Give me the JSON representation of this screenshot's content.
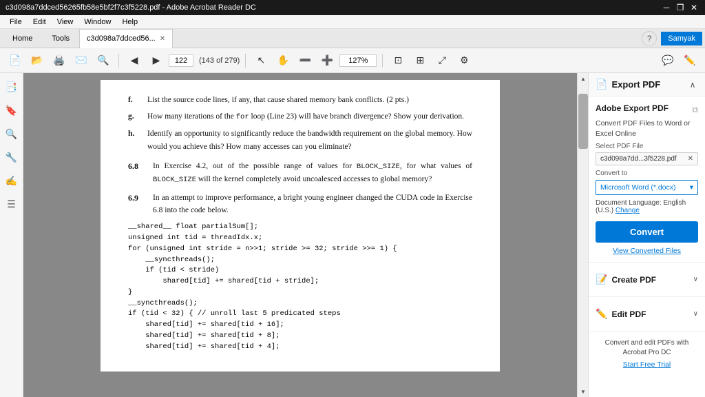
{
  "titlebar": {
    "title": "c3d098a7ddced56265fb58e5bf2f7c3f5228.pdf - Adobe Acrobat Reader DC",
    "minimize": "─",
    "restore": "❐",
    "close": "✕"
  },
  "menubar": {
    "items": [
      "File",
      "Edit",
      "View",
      "Window",
      "Help"
    ]
  },
  "tabs": {
    "home": "Home",
    "tools": "Tools",
    "doc": "c3d098a7ddced56...",
    "question_icon": "?",
    "user": "Samyak"
  },
  "toolbar": {
    "page_num": "122",
    "page_total": "(143 of 279)",
    "zoom": "127%"
  },
  "pdf": {
    "items_f_to_h": [
      {
        "label": "f.",
        "text": "List the source code lines, if any, that cause shared memory bank conflicts. (2 pts.)"
      },
      {
        "label": "g.",
        "text": "How many iterations of the for loop (Line 23) will have branch divergence? Show your derivation."
      },
      {
        "label": "h.",
        "text": "Identify an opportunity to significantly reduce the bandwidth requirement on the global memory. How would you achieve this? How many accesses can you eliminate?"
      }
    ],
    "section_6_8": {
      "num": "6.8",
      "text": "In Exercise 4.2, out of the possible range of values for BLOCK_SIZE, for what values of BLOCK_SIZE will the kernel completely avoid uncoalesced accesses to global memory?"
    },
    "section_6_9": {
      "num": "6.9",
      "text": "In an attempt to improve performance, a bright young engineer changed the CUDA code in Exercise 6.8 into the code below."
    },
    "code": "__shared__ float partialSum[];\nunsigned int tid = threadIdx.x;\nfor (unsigned int stride = n>>1; stride >= 32; stride >>= 1) {\n    __syncthreads();\n    if (tid < stride)\n        shared[tid] += shared[tid + stride];\n}\n__syncthreads();\nif (tid < 32) { // unroll last 5 predicated steps\n    shared[tid] += shared[tid + 16];\n    shared[tid] += shared[tid + 8];\n    shared[tid] += shared[tid + 4];"
  },
  "right_panel": {
    "export_pdf_title": "Export PDF",
    "adobe_export_title": "Adobe Export PDF",
    "adobe_export_icon": "📄",
    "description": "Convert PDF Files to Word or Excel Online",
    "select_file_label": "Select PDF File",
    "file_name": "c3d098a7dd...3f5228.pdf",
    "convert_to_label": "Convert to",
    "convert_to_value": "Microsoft Word (*.docx)",
    "doc_lang_label": "Document Language:",
    "doc_lang_value": "English (U.S.)",
    "change_label": "Change",
    "convert_btn": "Convert",
    "view_converted_label": "View Converted Files",
    "create_pdf_label": "Create PDF",
    "edit_pdf_label": "Edit PDF",
    "promo_text": "Convert and edit PDFs with Acrobat Pro DC",
    "start_trial_label": "Start Free Trial"
  }
}
